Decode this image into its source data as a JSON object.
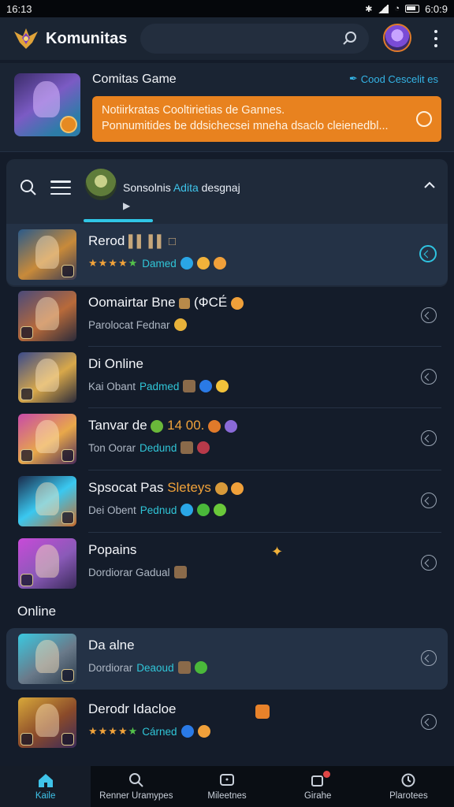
{
  "status_bar": {
    "time": "16:13",
    "right_time": "6:0:9"
  },
  "app": {
    "title": "Komunitas",
    "logo_icon": "winged-crest-logo-icon"
  },
  "banner": {
    "title": "Comitas Game",
    "link": "Cood Cescelit es",
    "promo_line1": "Notiirkratas Cooltirietias de Gannes.",
    "promo_line2": "Ponnumitides be ddsichecsei mneha dsaclo cleienedbl..."
  },
  "filter_bar": {
    "title_pre": "Sonsolnis ",
    "title_accent": "Adita",
    "title_post": " desgnaj",
    "cursor_glyph": "▶"
  },
  "rows": [
    {
      "name": "Rerod",
      "name_suffix": "▌▌ ▌▌ □",
      "status": "Damed",
      "has_stars": true
    },
    {
      "name": "Oomairtar Bne",
      "name_suffix": "(ФСЕ́",
      "sub": "Parolocat Fednar",
      "has_stars": false
    },
    {
      "name": "Di Online",
      "name_suffix": "",
      "sub": "Kai Obant",
      "status": "Padmed",
      "has_stars": false
    },
    {
      "name": "Tanvar de",
      "name_hl": "de",
      "name_suffix": "14 00.",
      "sub": "Ton Oorar",
      "status": "Dedund",
      "has_stars": false
    },
    {
      "name": "Spsocat Pas",
      "name_hl": "Sleteys",
      "name_suffix": "",
      "sub": "Dei Obent",
      "status": "Pednud",
      "has_stars": false
    },
    {
      "name": "Popains",
      "name_suffix": "",
      "sub": "Dordiorar Gadual",
      "has_stars": false
    },
    {
      "name": "Da alne",
      "name_suffix": "",
      "sub": "Dordiorar",
      "status": "Deaoud",
      "has_stars": false
    },
    {
      "name": "Derodr Idacloe",
      "name_suffix": "",
      "status": "Cárned",
      "has_stars": true
    }
  ],
  "section_label": "Online",
  "bottom_nav": [
    {
      "label": "Kaile",
      "icon": "home-icon",
      "active": true
    },
    {
      "label": "Renner Uramypes",
      "icon": "search-icon",
      "active": false
    },
    {
      "label": "Mileetnes",
      "icon": "message-square-icon",
      "active": false
    },
    {
      "label": "Girahe",
      "icon": "notification-icon",
      "active": false
    },
    {
      "label": "Plarotees",
      "icon": "clock-icon",
      "active": false
    }
  ],
  "colors": {
    "accent": "#30c6e6",
    "promo": "#e8821f",
    "bg": "#141c2a"
  }
}
